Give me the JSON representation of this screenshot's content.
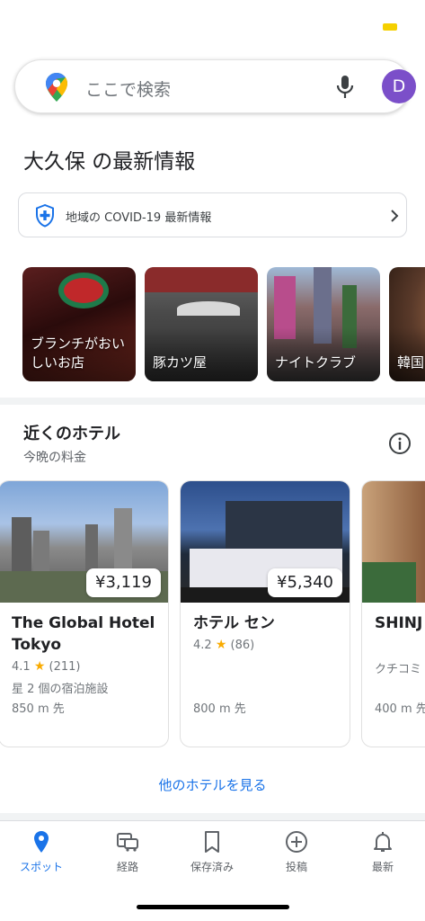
{
  "search": {
    "placeholder": "ここで検索",
    "avatar_initial": "D"
  },
  "area": {
    "title": "大久保 の最新情報"
  },
  "covid": {
    "label": "地域の COVID-19 最新情報"
  },
  "categories": [
    {
      "label": "ブランチがおいしいお店"
    },
    {
      "label": "豚カツ屋"
    },
    {
      "label": "ナイトクラブ"
    },
    {
      "label": "韓国"
    }
  ],
  "hotels_section": {
    "title": "近くのホテル",
    "subtitle": "今晩の料金",
    "more_label": "他のホテルを見る"
  },
  "hotels": [
    {
      "name": "The Global Hotel Tokyo",
      "price": "¥3,119",
      "rating": "4.1",
      "reviews": "(211)",
      "class": "星 2 個の宿泊施設",
      "distance": "850 m 先"
    },
    {
      "name": "ホテル セン",
      "price": "¥5,340",
      "rating": "4.2",
      "reviews": "(86)",
      "class": "",
      "distance": "800 m 先"
    },
    {
      "name": "SHINJ WARM",
      "price": "",
      "rating": "",
      "reviews": "",
      "class": "クチコミ",
      "distance": "400 m 先"
    }
  ],
  "nav": [
    {
      "label": "スポット",
      "icon": "location-pin-icon",
      "active": true
    },
    {
      "label": "経路",
      "icon": "commute-icon",
      "active": false
    },
    {
      "label": "保存済み",
      "icon": "bookmark-icon",
      "active": false
    },
    {
      "label": "投稿",
      "icon": "add-circle-icon",
      "active": false
    },
    {
      "label": "最新",
      "icon": "bell-icon",
      "active": false
    }
  ],
  "colors": {
    "accent": "#1a73e8",
    "avatar": "#7b4fc9",
    "star": "#f9ab00"
  }
}
